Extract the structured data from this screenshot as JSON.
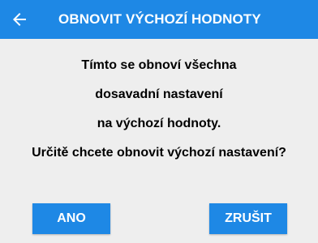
{
  "header": {
    "title": "OBNOVIT VÝCHOZÍ HODNOTY",
    "back_icon": "arrow-left-icon"
  },
  "message": {
    "line1": "Tímto se obnoví všechna",
    "line2": "dosavadní nastavení",
    "line3": "na výchozí hodnoty.",
    "line4": "Určitě chcete obnovit výchozí nastavení?"
  },
  "buttons": {
    "confirm_label": "ANO",
    "cancel_label": "ZRUŠIT"
  },
  "colors": {
    "accent": "#1e88e5",
    "background": "#eeeeee"
  }
}
